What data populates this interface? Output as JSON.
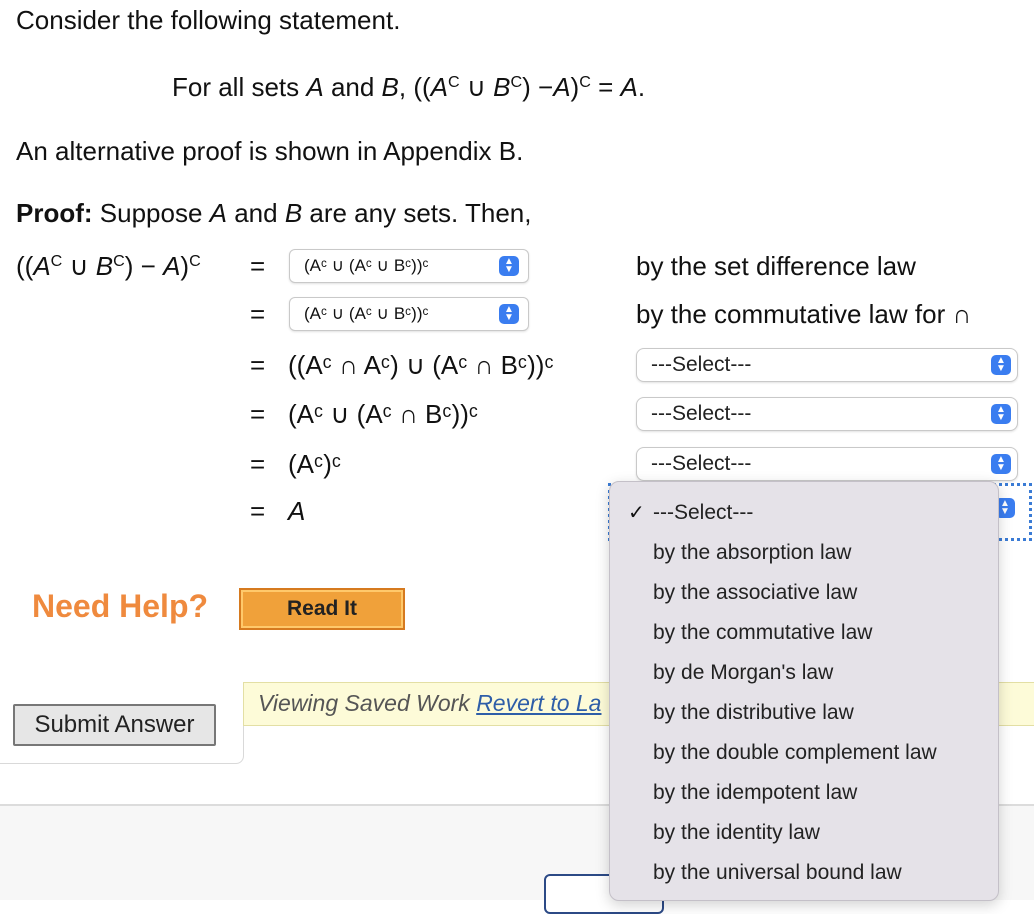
{
  "intro": "Consider the following statement.",
  "statement": {
    "prefix": "For all sets ",
    "A": "A",
    "and": " and ",
    "B": "B",
    "comma": ", ((",
    "mid1": " ∪ ",
    "mid2": ") −",
    "mid3": ")",
    "eq": " = ",
    "end": ".",
    "sup": "C"
  },
  "alternative": "An alternative proof is shown in Appendix B.",
  "proof": {
    "label": "Proof:",
    "text_1": " Suppose ",
    "A": "A",
    "text_2": " and ",
    "B": "B",
    "text_3": " are any sets. Then,"
  },
  "lhs": {
    "open": "((",
    "A": "A",
    "sup": "C",
    "union": " ∪ ",
    "B": "B",
    "minus": ") − ",
    "close": ")"
  },
  "steps": [
    {
      "eq": "=",
      "select_text": "(Aᶜ ∪ (Aᶜ ∪ Bᶜ))ᶜ",
      "reason": "by the set difference law"
    },
    {
      "eq": "=",
      "select_text": "(Aᶜ ∪ (Aᶜ ∪ Bᶜ))ᶜ",
      "reason": "by the commutative law for ∩"
    },
    {
      "eq": "=",
      "expr": "((Aᶜ ∩ Aᶜ) ∪ (Aᶜ ∩ Bᶜ))ᶜ",
      "select": "---Select---"
    },
    {
      "eq": "=",
      "expr": "(Aᶜ ∪ (Aᶜ ∩ Bᶜ))ᶜ",
      "select": "---Select---"
    },
    {
      "eq": "=",
      "expr": "(Aᶜ)ᶜ",
      "select": "---Select---"
    },
    {
      "eq": "=",
      "expr": "A"
    }
  ],
  "need_help": "Need Help?",
  "read_it": "Read It",
  "submit": "Submit Answer",
  "saved": {
    "text": "Viewing Saved Work ",
    "link": "Revert to La"
  },
  "dropdown": {
    "checked": "✓",
    "options": [
      "---Select---",
      "by the absorption law",
      "by the associative law",
      "by the commutative law",
      "by de Morgan's law",
      "by the distributive law",
      "by the double complement law",
      "by the idempotent law",
      "by the identity law",
      "by the universal bound law"
    ]
  },
  "colors": {
    "accent": "#3a7df0",
    "orange": "#ef8a3e",
    "menu_bg": "#e5e2e8"
  }
}
